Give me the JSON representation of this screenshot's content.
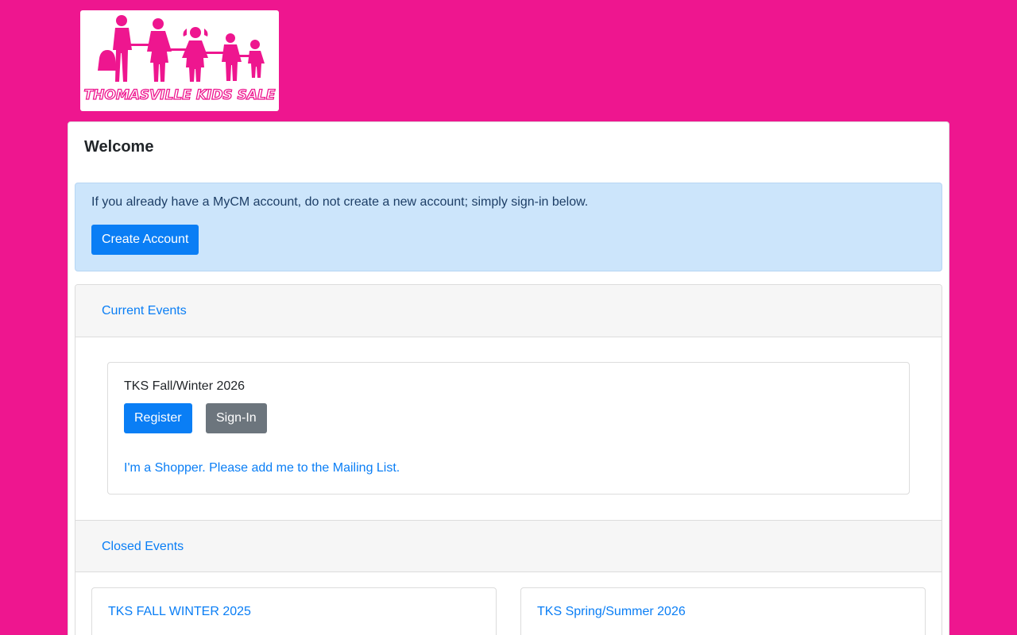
{
  "logo": {
    "text": "THOMASVILLE KIDS SALE"
  },
  "card": {
    "title": "Welcome"
  },
  "alert": {
    "text": "If you already have a MyCM account, do not create a new account; simply sign-in below.",
    "button_label": "Create Account"
  },
  "current_events": {
    "header": "Current Events",
    "event": {
      "title": "TKS Fall/Winter 2026",
      "register_label": "Register",
      "signin_label": "Sign-In",
      "mailing_link": "I'm a Shopper. Please add me to the Mailing List."
    }
  },
  "closed_events": {
    "header": "Closed Events",
    "items": [
      {
        "title": "TKS FALL WINTER 2025"
      },
      {
        "title": "TKS Spring/Summer 2026"
      }
    ]
  },
  "colors": {
    "page_background": "#ee168f",
    "primary": "#0a7ef5",
    "secondary": "#6c757d",
    "alert_background": "#cce5fb"
  },
  "icons": [
    "family-silhouette-logo"
  ]
}
